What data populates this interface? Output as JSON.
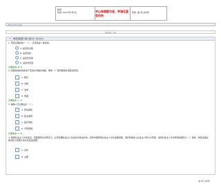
{
  "header": {
    "no_label": "编号:",
    "time_label": "时间: 2021年x月x日",
    "title": "书山有路勤为径，学海无涯苦作舟",
    "page_label": "页码: 第1页 共8页"
  },
  "top_bar": "课程名称/考试标题",
  "status_bar": "答题进度: 100",
  "section": {
    "title": "一、单项选择题 (每小题2分, 共50分)"
  },
  "questions": [
    {
      "q": "1. 劳动过程的第一（ ）。该活动是一种最佳。",
      "options": [
        "A. 是自然过程",
        "B. 是自然的",
        "C. 是自然生物",
        "D. 是自然创造"
      ],
      "answer": "正确答案: B, D"
    },
    {
      "q": "2. 我国某地的某种生产活动必须做好准备，规律（ ）规定要使并使其运营用。",
      "options": [
        "A. 规定",
        "B. 法规",
        "C. 法律",
        "D. 规章"
      ],
      "answer": "正确答案: C, D"
    },
    {
      "q": "3. 解除人员过程设计（ ）。",
      "options": [
        "A. 劳动保险",
        "B. 职业保险",
        "C. 医疗保险",
        "D. 养老保险"
      ],
      "answer": "正确答案: A, B"
    },
    {
      "q": "4. 能按社会主义文化建设，增强国家文化软实力，必须掌握社会主义先进文化前进方向，坚持中国特色社会主义文化发展道路，培养积极向上社会主义核心价值观，发挥社会主义文化繁荣发展巨大（ ）驱动，构建全面全部具和人民群众的文化权益保障。",
      "options": [
        "A. 主动",
        "B. 主要"
      ]
    }
  ],
  "footer": "第1页 共8页"
}
